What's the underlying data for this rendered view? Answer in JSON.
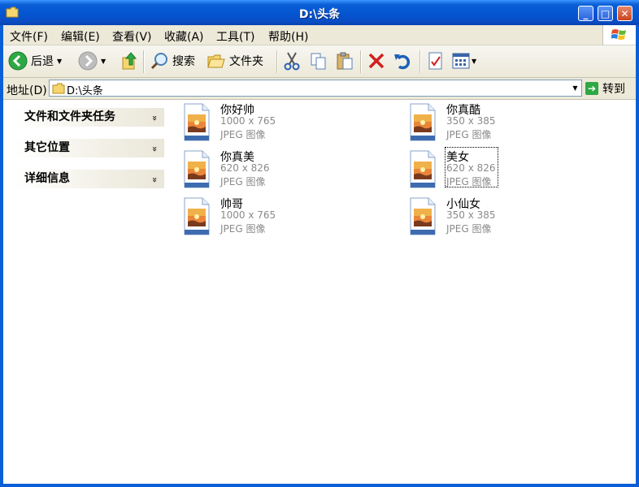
{
  "window": {
    "title": "D:\\头条"
  },
  "titlebar_buttons": {
    "minimize": "_",
    "maximize": "□",
    "close": "✕"
  },
  "menu": {
    "items": [
      {
        "label": "文件(F)"
      },
      {
        "label": "编辑(E)"
      },
      {
        "label": "查看(V)"
      },
      {
        "label": "收藏(A)"
      },
      {
        "label": "工具(T)"
      },
      {
        "label": "帮助(H)"
      }
    ]
  },
  "toolbar": {
    "back_label": "后退",
    "search_label": "搜索",
    "folders_label": "文件夹"
  },
  "address": {
    "label": "地址(D)",
    "value": "D:\\头条",
    "go_label": "转到"
  },
  "task_panel": {
    "sections": [
      {
        "title": "文件和文件夹任务"
      },
      {
        "title": "其它位置"
      },
      {
        "title": "详细信息"
      }
    ],
    "chevron": "»"
  },
  "files": [
    {
      "name": "你好帅",
      "dimensions": "1000 x 765",
      "type": "JPEG 图像"
    },
    {
      "name": "你真酷",
      "dimensions": "350 x 385",
      "type": "JPEG 图像"
    },
    {
      "name": "你真美",
      "dimensions": "620 x 826",
      "type": "JPEG 图像"
    },
    {
      "name": "美女",
      "dimensions": "620 x 826",
      "type": "JPEG 图像"
    },
    {
      "name": "帅哥",
      "dimensions": "1000 x 765",
      "type": "JPEG 图像"
    },
    {
      "name": "小仙女",
      "dimensions": "350 x 385",
      "type": "JPEG 图像"
    }
  ],
  "icons": {
    "folder": "folder-icon",
    "back": "back-arrow-icon",
    "forward": "forward-arrow-icon",
    "up": "up-folder-icon",
    "search": "search-icon",
    "folders": "folders-icon",
    "cut": "cut-icon",
    "copy": "copy-icon",
    "paste": "paste-icon",
    "delete": "delete-icon",
    "undo": "undo-icon",
    "properties": "properties-icon",
    "views": "views-icon",
    "go": "go-arrow-icon",
    "jpeg": "jpeg-file-icon"
  },
  "colors": {
    "titlebar": "#0a5fd6",
    "close_button": "#c8441e",
    "go_button": "#2ea844",
    "delete": "#d0201f",
    "back": "#2ea844"
  }
}
